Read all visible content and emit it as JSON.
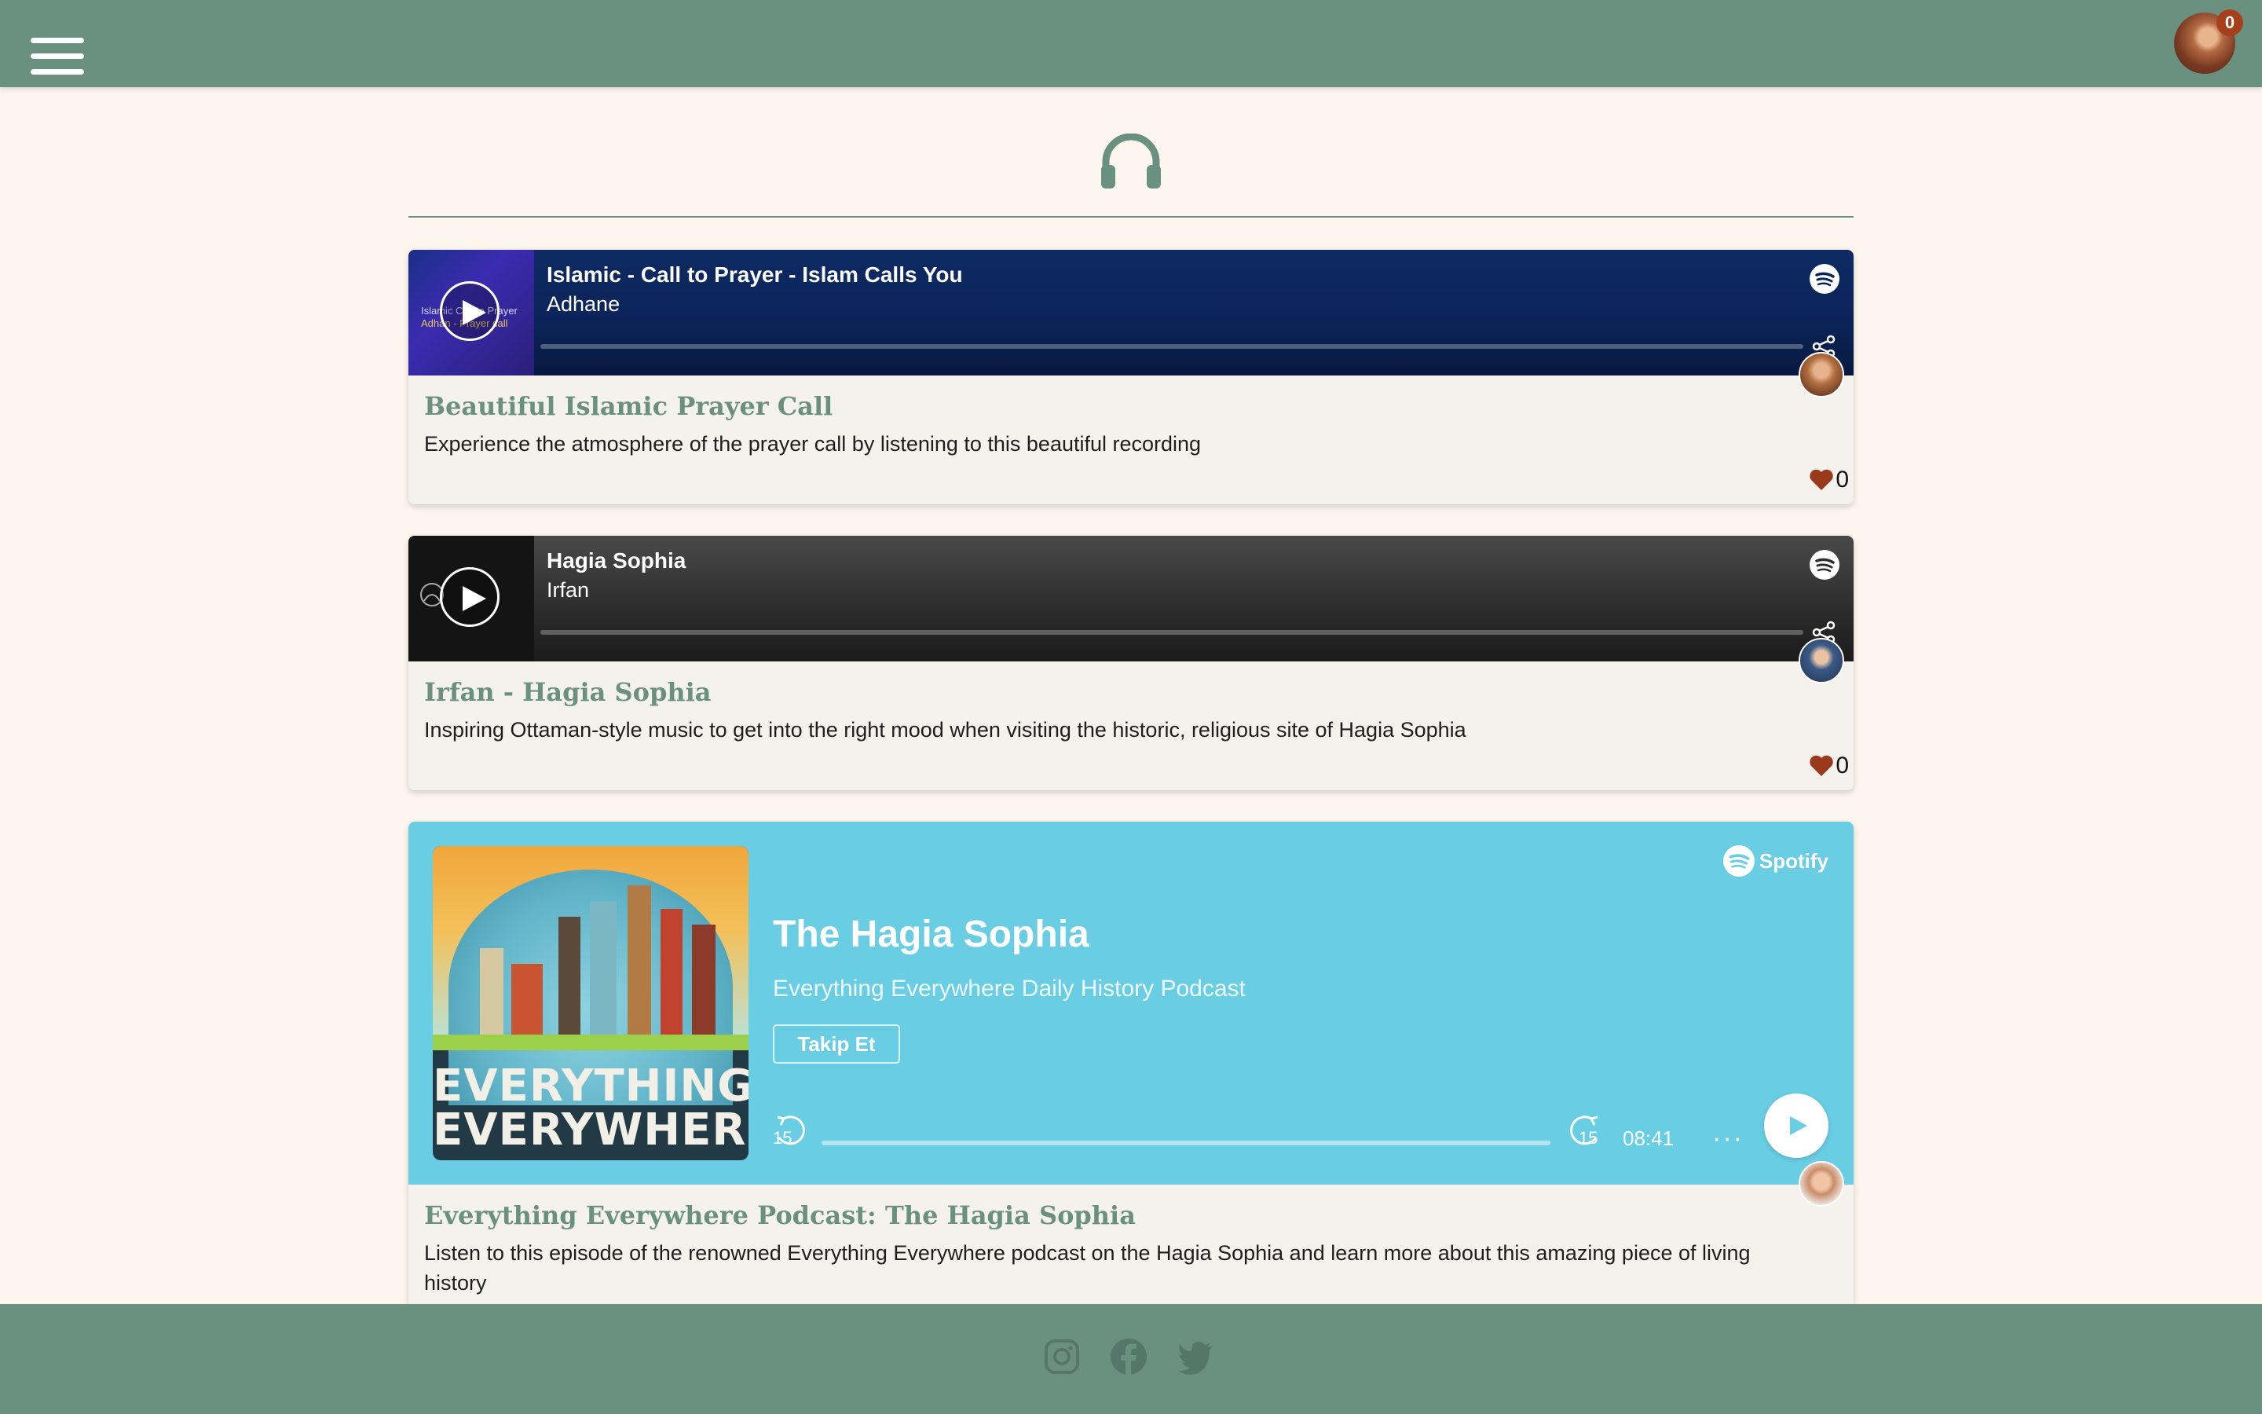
{
  "header": {
    "notification_count": "0",
    "menu_icon": "hamburger-icon",
    "avatar_icon": "user-avatar"
  },
  "page": {
    "section_icon": "headphones-icon",
    "accent_color": "#6a9080",
    "background_color": "#fdf6ee"
  },
  "cards": [
    {
      "player": {
        "cover_text_line1": "Islamic Call to Prayer",
        "cover_text_line2": "Adhan - Prayer call",
        "track_title": "Islamic - Call to Prayer - Islam Calls You",
        "artist": "Adhane"
      },
      "title": "Beautiful Islamic Prayer Call",
      "description": "Experience the atmosphere of the prayer call by listening to this beautiful recording",
      "likes": "0"
    },
    {
      "player": {
        "track_title": "Hagia Sophia",
        "artist": "Irfan"
      },
      "title": "Irfan - Hagia Sophia",
      "description": "Inspiring Ottaman-style music to get into the right mood when visiting the historic, religious site of Hagia Sophia",
      "likes": "0"
    },
    {
      "embed": {
        "brand": "Spotify",
        "art_text_line1": "EVERYTHING",
        "art_text_line2": "EVERYWHERE",
        "episode_title": "The Hagia Sophia",
        "show_name": "Everything Everywhere Daily History Podcast",
        "follow_label": "Takip Et",
        "skip_back": "15",
        "skip_forward": "15",
        "duration": "08:41",
        "more_label": "···",
        "background_color": "#69cde4"
      },
      "title": "Everything Everywhere Podcast: The Hagia Sophia",
      "description": "Listen to this episode of the renowned Everything Everywhere podcast on the Hagia Sophia and learn more about this amazing piece of living history"
    }
  ],
  "footer": {
    "icons": [
      "instagram-icon",
      "facebook-icon",
      "twitter-icon"
    ]
  }
}
